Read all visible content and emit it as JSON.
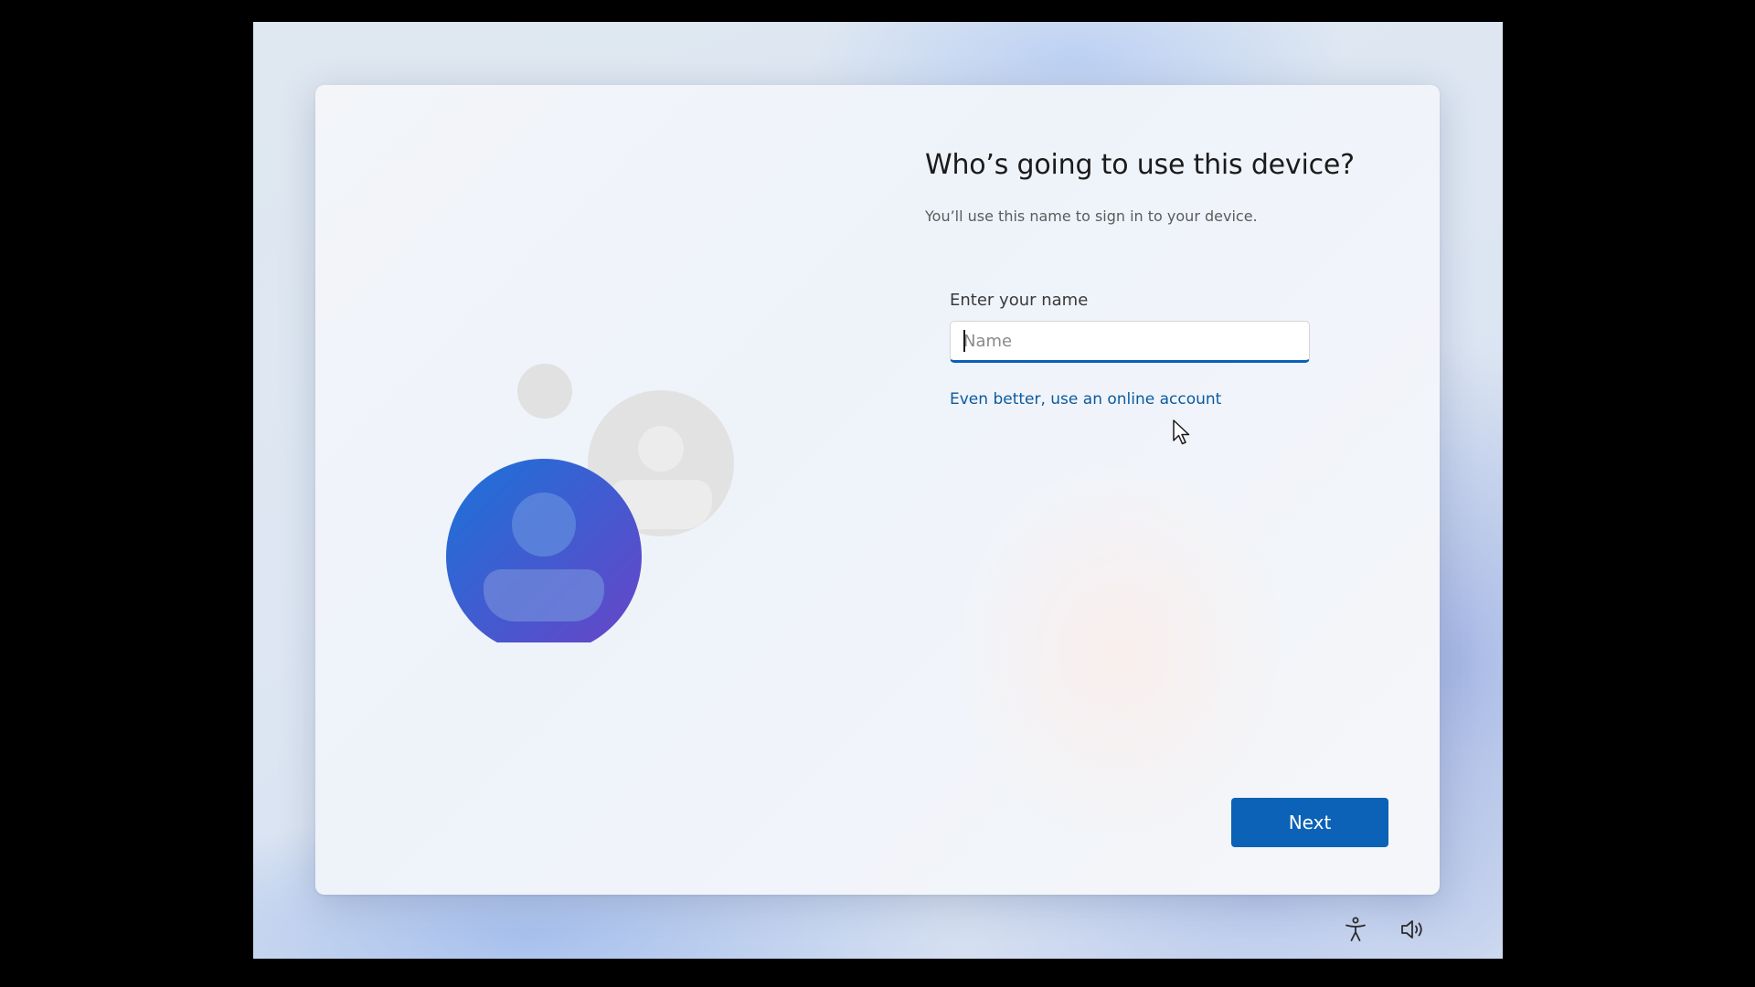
{
  "page": {
    "title": "Who’s going to use this device?",
    "subtitle": "You’ll use this name to sign in to your device."
  },
  "name_field": {
    "label": "Enter your name",
    "placeholder": "Name",
    "value": ""
  },
  "links": {
    "online_account": "Even better, use an online account"
  },
  "buttons": {
    "next": "Next"
  },
  "system_icons": [
    "accessibility-icon",
    "volume-icon"
  ],
  "colors": {
    "accent": "#0b62b6",
    "link": "#0b5a9e",
    "avatar_primary_start": "#1f6fd6",
    "avatar_primary_end": "#6a45c9",
    "avatar_secondary": "#e0e0e0"
  }
}
